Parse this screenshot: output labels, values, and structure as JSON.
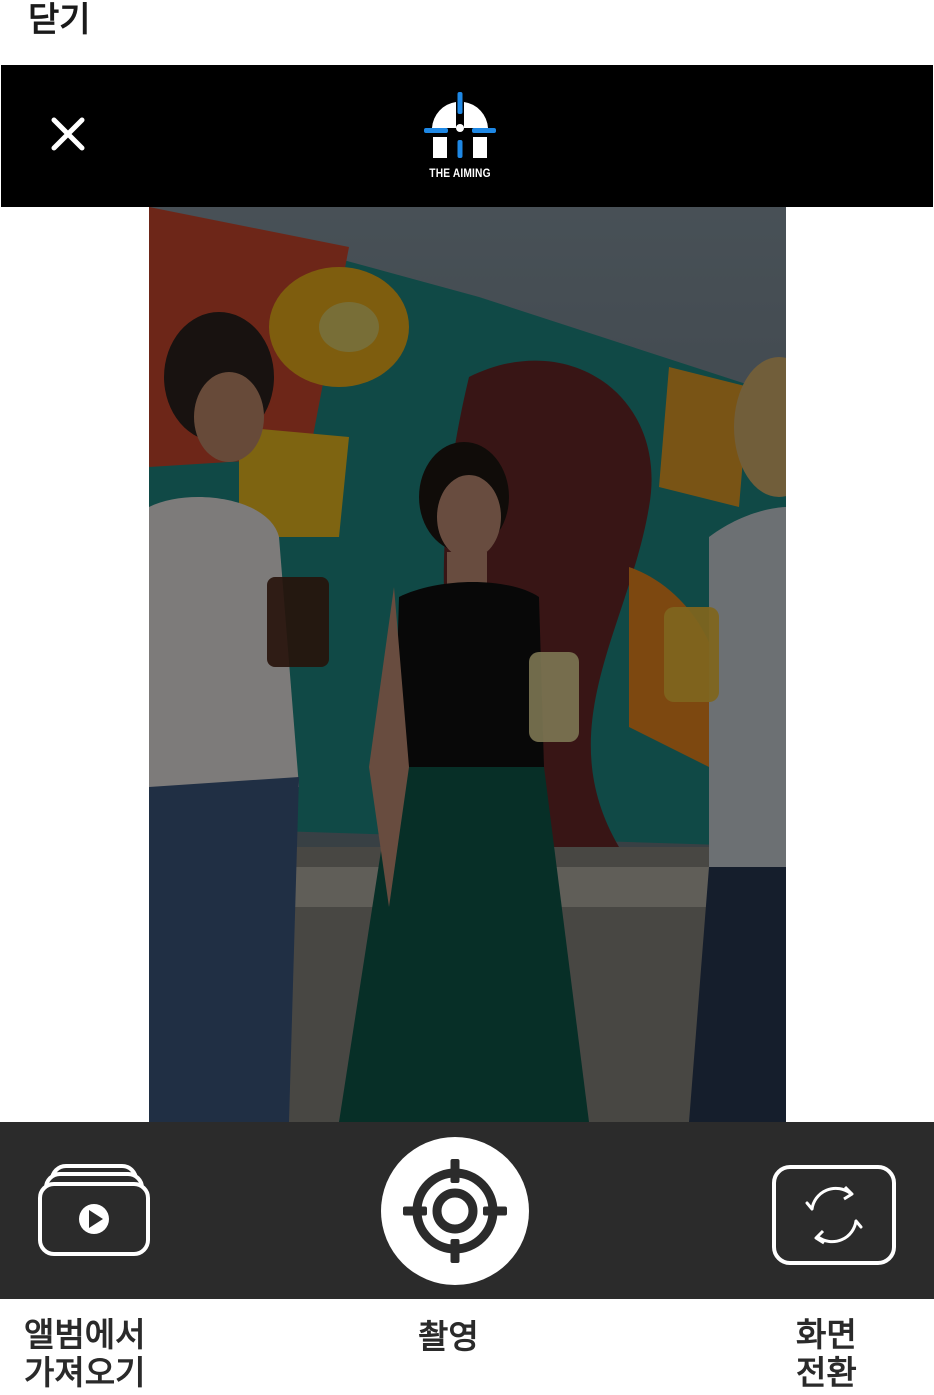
{
  "top_bar": {
    "close_label": "닫기"
  },
  "header": {
    "close_icon": "close-icon",
    "logo_icon": "the-aiming-logo",
    "logo_text": "THE AIMING",
    "colors": {
      "background": "#000000",
      "logo_blue": "#1e88e5"
    }
  },
  "camera": {
    "preview": "camera-preview",
    "overlay_color": "#000000"
  },
  "controls": {
    "background": "#2b2b2b",
    "album": {
      "icon": "album-stack-play-icon",
      "label_line1": "앨범에서",
      "label_line2": "가져오기"
    },
    "shoot": {
      "icon": "crosshair-target-icon",
      "label": "촬영"
    },
    "switch": {
      "icon": "camera-switch-icon",
      "label_line1": "화면",
      "label_line2": "전환"
    }
  }
}
